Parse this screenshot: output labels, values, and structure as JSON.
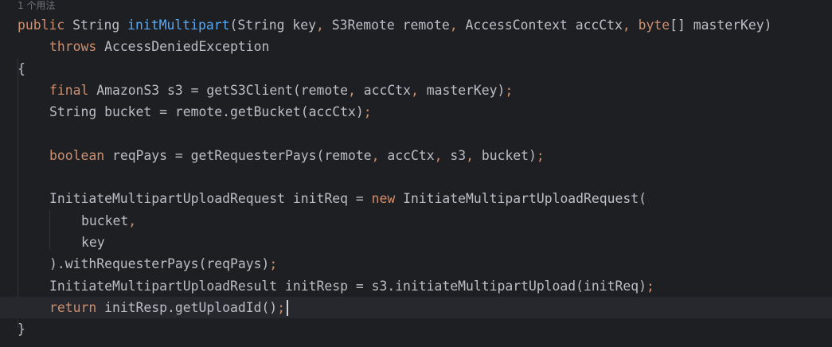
{
  "editor": {
    "usage_hint": "1 个用法",
    "lines": [
      {
        "indent": 0,
        "tokens": [
          {
            "t": "public ",
            "c": "kw"
          },
          {
            "t": "String ",
            "c": "plain"
          },
          {
            "t": "initMultipart",
            "c": "fn"
          },
          {
            "t": "(String key",
            "c": "plain"
          },
          {
            "t": ", ",
            "c": "punc"
          },
          {
            "t": "S3Remote remote",
            "c": "plain"
          },
          {
            "t": ", ",
            "c": "punc"
          },
          {
            "t": "AccessContext accCtx",
            "c": "plain"
          },
          {
            "t": ", ",
            "c": "punc"
          },
          {
            "t": "byte",
            "c": "kw"
          },
          {
            "t": "[] masterKey)",
            "c": "plain"
          }
        ]
      },
      {
        "indent": 1,
        "tokens": [
          {
            "t": "throws ",
            "c": "kw"
          },
          {
            "t": "AccessDeniedException",
            "c": "plain"
          }
        ]
      },
      {
        "indent": 0,
        "tokens": [
          {
            "t": "{",
            "c": "plain"
          }
        ]
      },
      {
        "indent": 1,
        "tokens": [
          {
            "t": "final ",
            "c": "kw"
          },
          {
            "t": "AmazonS3 s3 = getS3Client(remote",
            "c": "plain"
          },
          {
            "t": ", ",
            "c": "punc"
          },
          {
            "t": "accCtx",
            "c": "plain"
          },
          {
            "t": ", ",
            "c": "punc"
          },
          {
            "t": "masterKey)",
            "c": "plain"
          },
          {
            "t": ";",
            "c": "punc"
          }
        ]
      },
      {
        "indent": 1,
        "tokens": [
          {
            "t": "String bucket = remote.getBucket(accCtx)",
            "c": "plain"
          },
          {
            "t": ";",
            "c": "punc"
          }
        ]
      },
      {
        "indent": 0,
        "tokens": []
      },
      {
        "indent": 1,
        "tokens": [
          {
            "t": "boolean ",
            "c": "kw"
          },
          {
            "t": "reqPays = getRequesterPays(remote",
            "c": "plain"
          },
          {
            "t": ", ",
            "c": "punc"
          },
          {
            "t": "accCtx",
            "c": "plain"
          },
          {
            "t": ", ",
            "c": "punc"
          },
          {
            "t": "s3",
            "c": "plain"
          },
          {
            "t": ", ",
            "c": "punc"
          },
          {
            "t": "bucket)",
            "c": "plain"
          },
          {
            "t": ";",
            "c": "punc"
          }
        ]
      },
      {
        "indent": 0,
        "tokens": []
      },
      {
        "indent": 1,
        "tokens": [
          {
            "t": "InitiateMultipartUploadRequest initReq = ",
            "c": "plain"
          },
          {
            "t": "new ",
            "c": "kw"
          },
          {
            "t": "InitiateMultipartUploadRequest(",
            "c": "plain"
          }
        ]
      },
      {
        "indent": 2,
        "tokens": [
          {
            "t": "bucket",
            "c": "plain"
          },
          {
            "t": ",",
            "c": "punc"
          }
        ]
      },
      {
        "indent": 2,
        "tokens": [
          {
            "t": "key",
            "c": "plain"
          }
        ]
      },
      {
        "indent": 1,
        "tokens": [
          {
            "t": ").withRequesterPays(reqPays)",
            "c": "plain"
          },
          {
            "t": ";",
            "c": "punc"
          }
        ]
      },
      {
        "indent": 1,
        "tokens": [
          {
            "t": "InitiateMultipartUploadResult initResp = s3.initiateMultipartUpload(initReq)",
            "c": "plain"
          },
          {
            "t": ";",
            "c": "punc"
          }
        ]
      },
      {
        "indent": 1,
        "current": true,
        "caret": true,
        "tokens": [
          {
            "t": "return ",
            "c": "kw"
          },
          {
            "t": "initResp.getUploadId()",
            "c": "plain"
          },
          {
            "t": ";",
            "c": "punc"
          }
        ]
      },
      {
        "indent": 0,
        "tokens": [
          {
            "t": "}",
            "c": "plain"
          }
        ]
      }
    ]
  },
  "gutter": {
    "intention_icon": "lightbulb-icon",
    "intention_color": "#f2c55c"
  },
  "theme": {
    "background": "#1e1f22",
    "keyword": "#cf8e6d",
    "method_declaration": "#56a8f5",
    "text": "#bcbec4"
  }
}
